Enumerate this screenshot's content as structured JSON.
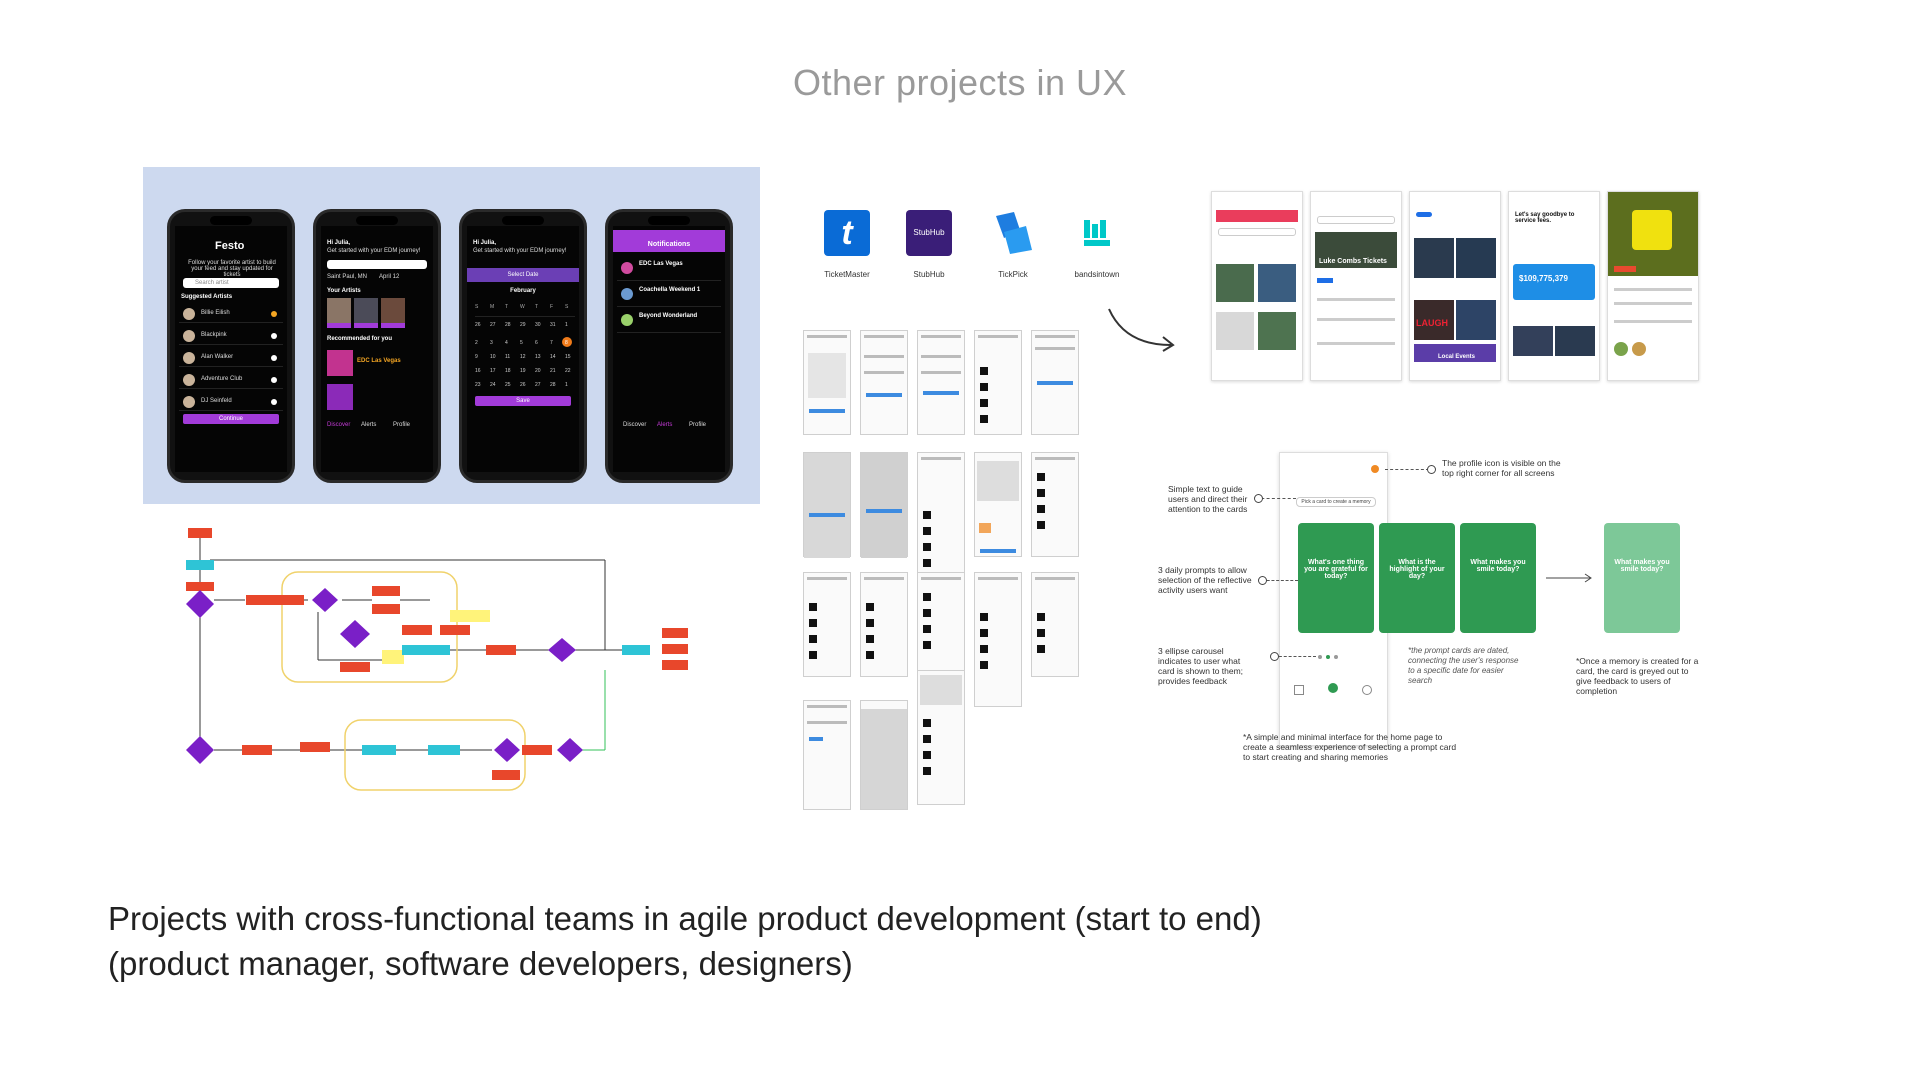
{
  "page": {
    "title": "Other projects in UX",
    "caption_line1": "Projects with cross-functional teams in agile product development (start to end)",
    "caption_line2": "(product manager, software developers, designers)"
  },
  "festo": {
    "brand": "Festo",
    "intro": "Follow your favorite artist to build your feed and stay updated for tickets",
    "search_placeholder": "Search artist",
    "suggested_title": "Suggested Artists",
    "artists": [
      "Billie Eilish",
      "Blackpink",
      "Alan Walker",
      "Adventure Club",
      "DJ Seinfeld"
    ],
    "continue_label": "Continue",
    "greeting": "Hi Julia,",
    "greeting_sub": "Get started with your EDM journey!",
    "location": "Saint Paul, MN",
    "date_chip": "April 12",
    "your_artists": "Your Artists",
    "show_more": "Show More",
    "recommended": "Recommended for you",
    "event_name": "EDC Las Vegas",
    "select_date": "Select Date",
    "month": "February",
    "save_label": "Save",
    "notifications_title": "Notifications",
    "notifications": [
      "EDC Las Vegas",
      "Coachella Weekend 1",
      "Beyond Wonderland"
    ],
    "nav": [
      "Discover",
      "Alerts",
      "Profile"
    ]
  },
  "logos": [
    {
      "name": "TicketMaster",
      "color": "#0a6bd6",
      "glyph": "t"
    },
    {
      "name": "StubHub",
      "color": "#3a1e78",
      "glyph": "StubHub"
    },
    {
      "name": "TickPick",
      "color": "#1e7de0",
      "glyph": ""
    },
    {
      "name": "bandsintown",
      "color": "#00c8c8",
      "glyph": ""
    }
  ],
  "hifi": {
    "headline": "Let's say goodbye to service fees.",
    "amount": "$109,775,379",
    "banner": "Luke Combs Tickets",
    "laugh": "LAUGH",
    "local": "Local Events"
  },
  "memories": {
    "home_label": "Pick a card to create a memory",
    "cards": [
      "What's one thing you are grateful for today?",
      "What is the highlight of your day?",
      "What makes you smile today?"
    ],
    "greyed_card": "What makes you smile today?",
    "notes": {
      "profile": "The profile icon is visible on the top right corner for all screens",
      "simple": "Simple text to guide users and direct their attention to the cards",
      "daily": "3 daily prompts to allow selection of the reflective activity users want",
      "ellipse": "3 ellipse carousel indicates to user what card is shown to them; provides feedback",
      "dated": "*the prompt cards are dated, connecting the user's response to a specific date for easier search",
      "once": "*Once a memory is created for a card, the card is greyed out to give feedback to users of completion",
      "minimal": "*A simple and minimal interface for the home page to create a seamless experience of selecting a prompt card to start creating and sharing memories"
    }
  }
}
